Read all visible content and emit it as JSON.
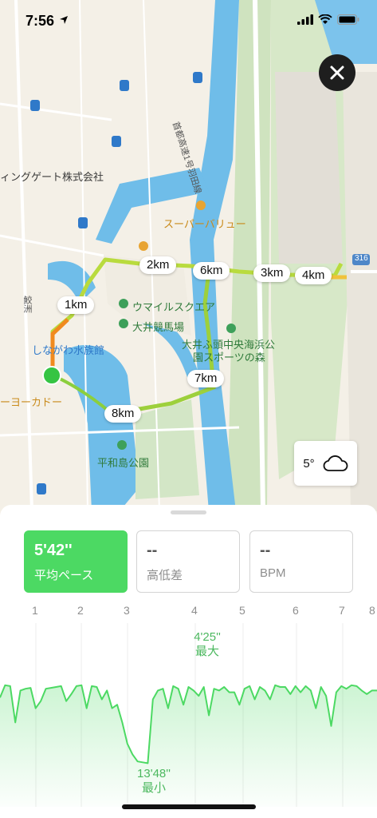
{
  "status_bar": {
    "time": "7:56"
  },
  "map": {
    "labels": {
      "company": "ィングゲート株式会社",
      "supermarket": "スーパーバリュー",
      "umairu": "ウマイルスクエア",
      "racecourse": "大井競馬場",
      "aquarium": "しながわ水族館",
      "park1_line1": "大井ふ頭中央海浜公",
      "park1_line2": "園スポーツの森",
      "park2": "平和島公園",
      "yokado": "ーヨーカドー",
      "expressway": "首都高速1号羽田線",
      "road_num": "316",
      "station": "鮫洲"
    },
    "km_markers": [
      "1km",
      "2km",
      "3km",
      "4km",
      "6km",
      "7km",
      "8km"
    ]
  },
  "weather": {
    "temperature": "5°",
    "icon": "cloud-icon"
  },
  "stats": {
    "pace": {
      "value": "5'42''",
      "label": "平均ペース"
    },
    "elevation": {
      "value": "--",
      "label": "高低差"
    },
    "heart_rate": {
      "value": "--",
      "label": "BPM"
    }
  },
  "chart_data": {
    "type": "line",
    "x_ticks": [
      "1",
      "2",
      "3",
      "4",
      "5",
      "6",
      "7",
      "8"
    ],
    "max_label": "4'25''",
    "max_caption": "最大",
    "min_label": "13'48''",
    "min_caption": "最小",
    "line_color": "#4cd963",
    "pace_seconds": [
      460,
      390,
      395,
      600,
      420,
      410,
      405,
      520,
      480,
      410,
      405,
      400,
      395,
      480,
      440,
      395,
      390,
      520,
      395,
      400,
      470,
      420,
      520,
      500,
      600,
      720,
      780,
      820,
      825,
      830,
      470,
      420,
      410,
      520,
      395,
      410,
      500,
      400,
      420,
      450,
      400,
      560,
      410,
      420,
      400,
      430,
      430,
      500,
      410,
      395,
      470,
      400,
      420,
      470,
      390,
      400,
      400,
      440,
      395,
      430,
      395,
      420,
      520,
      400,
      450,
      620,
      430,
      395,
      410,
      390,
      395,
      420,
      440,
      420,
      420
    ],
    "y_fast_seconds": 265,
    "y_slow_seconds": 828
  }
}
